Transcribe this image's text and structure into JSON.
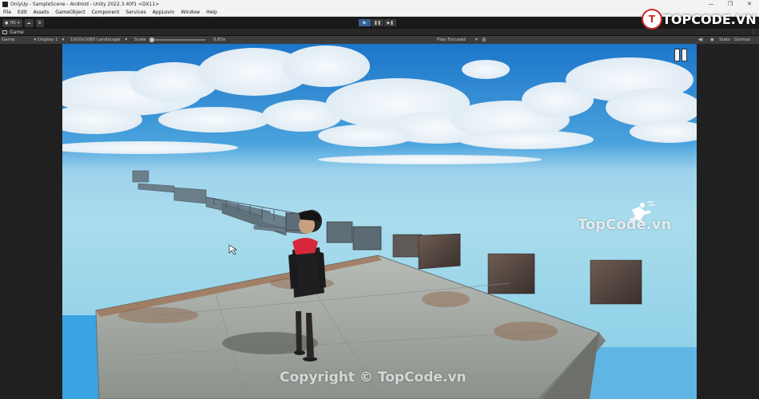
{
  "window": {
    "title": "OnlyUp - SampleScene - Android - Unity 2022.3.40f1 <DX11>",
    "controls": [
      "—",
      "❐",
      "✕"
    ]
  },
  "menu": [
    "File",
    "Edit",
    "Assets",
    "GameObject",
    "Component",
    "Services",
    "AppLovin",
    "Window",
    "Help"
  ],
  "toolbar": {
    "account_label": "HD",
    "play_icon": "▶",
    "pause_icon": "❚❚",
    "step_icon": "▶❚"
  },
  "game_tab": {
    "label": "Game",
    "menu": "⋮"
  },
  "game_bar": {
    "view_select": "Game",
    "display_select": "Display 1",
    "resolution_select": "1920x1080 Landscape",
    "scale_label": "Scale",
    "scale_value": "0.83x",
    "scale_fraction": 0.0,
    "play_focused": "Play Focused",
    "stats_label": "Stats",
    "gizmos_label": "Gizmos"
  },
  "watermarks": {
    "logo_text": "TOPCODE.VN",
    "center_text": "TopCode.vn",
    "copyright_text": "Copyright © TopCode.vn"
  },
  "colors": {
    "sky_top": "#1c75c9",
    "sky_horizon": "#a9dcec",
    "accent_play": "#3b5f8c",
    "scarf": "#d6283a"
  }
}
